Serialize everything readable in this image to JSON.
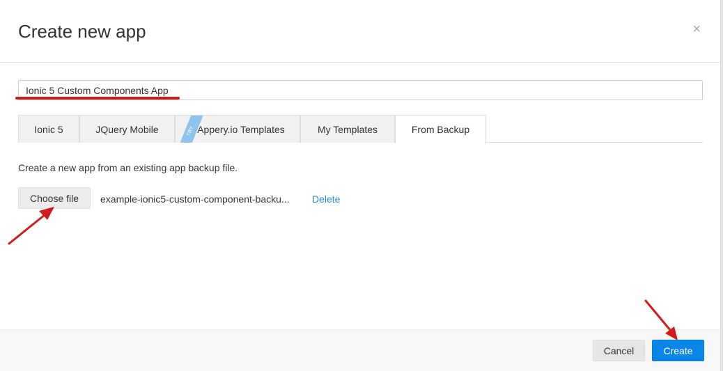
{
  "dialog": {
    "title": "Create new app",
    "close_icon": "×"
  },
  "app_name": {
    "value": "Ionic 5 Custom Components App"
  },
  "tabs": [
    {
      "label": "Ionic 5",
      "active": false
    },
    {
      "label": "JQuery Mobile",
      "active": false
    },
    {
      "label": "Appery.io Templates",
      "active": false,
      "ribbon": "TRY"
    },
    {
      "label": "My Templates",
      "active": false
    },
    {
      "label": "From Backup",
      "active": true
    }
  ],
  "backup": {
    "description": "Create a new app from an existing app backup file.",
    "choose_file_label": "Choose file",
    "file_name": "example-ionic5-custom-component-backu...",
    "delete_label": "Delete"
  },
  "footer": {
    "cancel_label": "Cancel",
    "create_label": "Create"
  },
  "colors": {
    "accent": "#0a85e8",
    "annotation": "#d11a1a",
    "link": "#2a8ad4"
  }
}
